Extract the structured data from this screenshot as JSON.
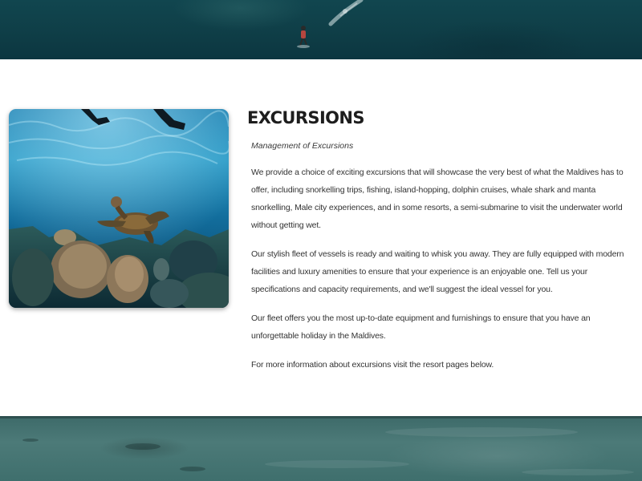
{
  "hero_top": {
    "icon": "ocean-kitesurfer-image"
  },
  "section": {
    "title": "EXCURSIONS",
    "subtitle": "Management of Excursions",
    "paragraphs": [
      "We provide a choice of exciting excursions that will showcase the very best of what the Maldives has to offer, including snorkelling trips, fishing, island-hopping, dolphin cruises, whale shark and manta snorkelling, Male city experiences, and in some resorts, a semi-submarine to visit the underwater world without getting wet.",
      "Our stylish fleet of vessels is ready and waiting to whisk you away. They are fully equipped with modern facilities and luxury amenities to ensure that your experience is an enjoyable one. Tell us your specifications and capacity requirements, and we'll suggest the ideal vessel for you.",
      "Our fleet offers you the most up-to-date equipment and furnishings to ensure that you have an unforgettable holiday in the Maldives.",
      "For more information about excursions visit the resort pages below."
    ]
  },
  "photo": {
    "icon": "sea-turtle-reef-image"
  },
  "hero_bottom": {
    "icon": "shallow-water-image"
  },
  "colors": {
    "ocean_dark": "#0f3f48",
    "shallow_water": "#4c7a78",
    "heading": "#1d1d1d",
    "body_text": "#333333"
  }
}
